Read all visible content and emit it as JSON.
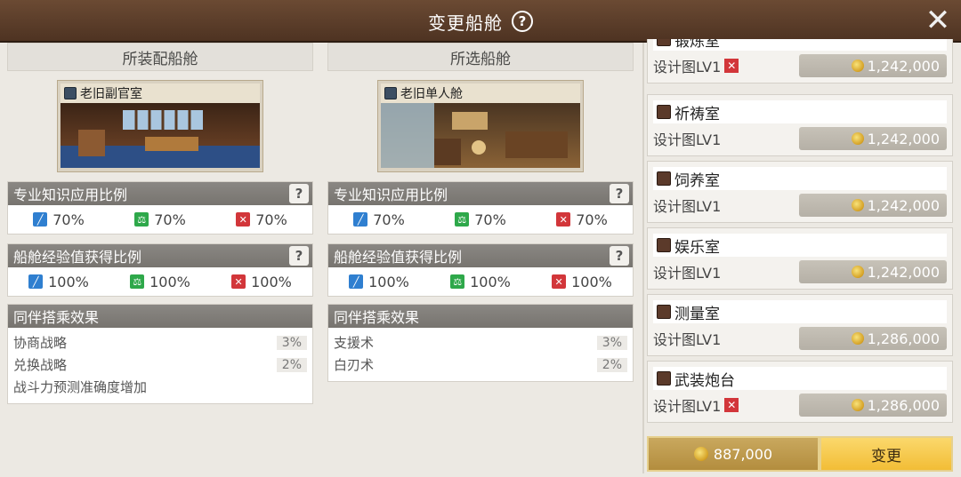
{
  "dialog": {
    "title": "变更船舱",
    "help_icon": "question-circle-icon",
    "close_icon": "close-icon"
  },
  "equipped": {
    "header": "所装配船舱",
    "ship": {
      "name": "老旧副官室"
    },
    "knowledge": {
      "title": "专业知识应用比例",
      "values": [
        "70%",
        "70%",
        "70%"
      ]
    },
    "exp": {
      "title": "船舱经验值获得比例",
      "values": [
        "100%",
        "100%",
        "100%"
      ]
    },
    "companion": {
      "title": "同伴搭乘效果",
      "rows": [
        {
          "label": "协商战略",
          "value": "3%"
        },
        {
          "label": "兑换战略",
          "value": "2%"
        },
        {
          "label": "战斗力预测准确度增加",
          "value": ""
        }
      ]
    }
  },
  "selected": {
    "header": "所选船舱",
    "ship": {
      "name": "老旧单人舱"
    },
    "knowledge": {
      "title": "专业知识应用比例",
      "values": [
        "70%",
        "70%",
        "70%"
      ]
    },
    "exp": {
      "title": "船舱经验值获得比例",
      "values": [
        "100%",
        "100%",
        "100%"
      ]
    },
    "companion": {
      "title": "同伴搭乘效果",
      "rows": [
        {
          "label": "支援术",
          "value": "3%"
        },
        {
          "label": "白刃术",
          "value": "2%"
        }
      ]
    }
  },
  "rooms": [
    {
      "name": "锻炼室",
      "blueprint": "设计图LV1",
      "missing": true,
      "price": "1,242,000"
    },
    {
      "name": "祈祷室",
      "blueprint": "设计图LV1",
      "missing": false,
      "price": "1,242,000"
    },
    {
      "name": "饲养室",
      "blueprint": "设计图LV1",
      "missing": false,
      "price": "1,242,000"
    },
    {
      "name": "娱乐室",
      "blueprint": "设计图LV1",
      "missing": false,
      "price": "1,242,000"
    },
    {
      "name": "测量室",
      "blueprint": "设计图LV1",
      "missing": false,
      "price": "1,286,000"
    },
    {
      "name": "武装炮台",
      "blueprint": "设计图LV1",
      "missing": true,
      "price": "1,286,000"
    }
  ],
  "footer": {
    "cost": "887,000",
    "change_label": "变更"
  },
  "icons": {
    "ship_cube": "cube-icon",
    "room_chest": "chest-icon",
    "coin": "gold-coin-icon",
    "stat_blue": "sword-blue-icon",
    "stat_green": "scale-green-icon",
    "stat_red": "cross-swords-red-icon",
    "missing_mark": "red-x-icon"
  },
  "colors": {
    "titlebar": "#5c3f2b",
    "panel": "#ece9e3",
    "stat_header": "#807d78",
    "price_pill": "#bdb8ae",
    "change_button": "#f6c94c",
    "missing": "#d2363a"
  }
}
